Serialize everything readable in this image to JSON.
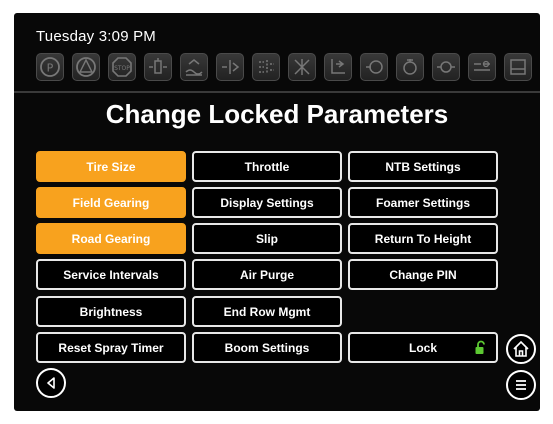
{
  "status": {
    "datetime": "Tuesday 3:09 PM"
  },
  "toolbar_icons": [
    "parking-brake-icon",
    "warning-icon",
    "stop-icon",
    "boom-section-icon",
    "sprayer-flow-icon",
    "boom-fold-icon",
    "nozzle-icon",
    "spray-pattern-icon",
    "rinse-icon",
    "tank-icon",
    "agitation-icon",
    "pump-icon",
    "fluid-level-icon"
  ],
  "title": "Change Locked Parameters",
  "buttons": {
    "tire_size": "Tire Size",
    "field_gearing": "Field Gearing",
    "road_gearing": "Road Gearing",
    "service_intervals": "Service Intervals",
    "brightness": "Brightness",
    "reset_spray_timer": "Reset Spray Timer",
    "throttle": "Throttle",
    "display_settings": "Display Settings",
    "slip": "Slip",
    "air_purge": "Air Purge",
    "end_row_mgmt": "End Row Mgmt",
    "boom_settings": "Boom Settings",
    "ntb_settings": "NTB Settings",
    "foamer_settings": "Foamer Settings",
    "return_to_height": "Return To Height",
    "change_pin": "Change PIN",
    "lock": "Lock"
  },
  "colors": {
    "active": "#f8a21e",
    "unlock_icon": "#5cc832",
    "background": "#080808"
  }
}
